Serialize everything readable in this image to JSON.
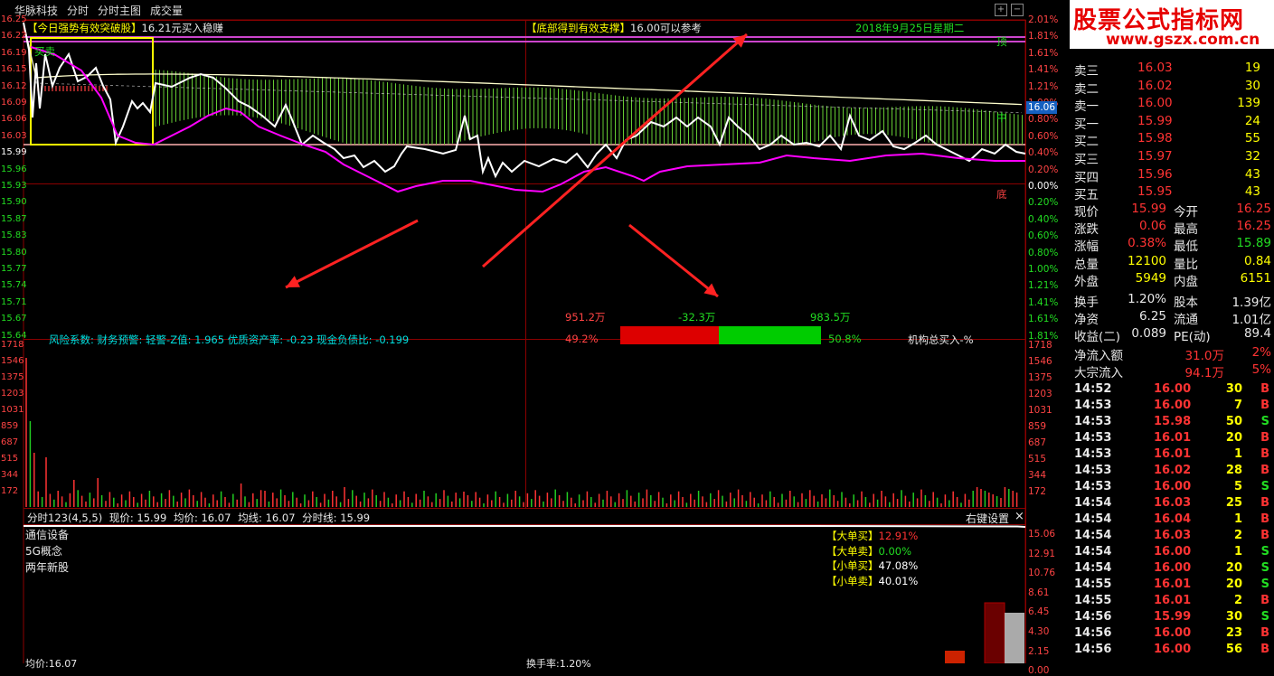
{
  "header": {
    "tabs": [
      "华脉科技",
      "分时",
      "分时主图",
      "成交量"
    ]
  },
  "price_axis_left": [
    "16.25",
    "16.22",
    "16.19",
    "16.15",
    "16.12",
    "16.09",
    "16.06",
    "16.03",
    "15.99",
    "15.96",
    "15.93",
    "15.90",
    "15.87",
    "15.83",
    "15.80",
    "15.77",
    "15.74",
    "15.71",
    "15.67",
    "15.64"
  ],
  "pct_axis_right": [
    "2.01%",
    "1.81%",
    "1.61%",
    "1.41%",
    "1.21%",
    "1.00%",
    "0.80%",
    "0.60%",
    "0.40%",
    "0.20%",
    "0.00%",
    "0.20%",
    "0.40%",
    "0.60%",
    "0.80%",
    "1.00%",
    "1.21%",
    "1.41%",
    "1.61%",
    "1.81%"
  ],
  "current_price_tag": "16.06",
  "annotations": {
    "signal1_a": "【今日强势有效突破股】",
    "signal1_b": "16.21元买入稳赚",
    "signal2_a": "【底部得到有效支撑】",
    "signal2_b": "16.00可以参考",
    "date": "2018年9月25日星期二",
    "top_label": "顶",
    "mid_label": "中",
    "bottom_label": "底",
    "buy_sell_label": "买卖",
    "risk_text": "风险系数: 财务预警: 轻警-Z值: 1.965 优质资产率: -0.23 现金负债比: -0.199",
    "flow_left_amt": "951.2万",
    "flow_mid_amt": "-32.3万",
    "flow_right_amt": "983.5万",
    "flow_left_pct": "49.2%",
    "flow_right_pct": "50.8%",
    "inst_buy": "机构总买入-%"
  },
  "flow_bar": {
    "red_fraction": 0.492,
    "red_color": "#dd0000",
    "green_color": "#00cc00"
  },
  "volume_axis": [
    "1718",
    "1546",
    "1375",
    "1203",
    "1031",
    "859",
    "687",
    "515",
    "344",
    "172"
  ],
  "indicator_bar": {
    "title": "分时123(4,5,5)",
    "now_price": "现价: 15.99",
    "avg_price": "均价: 16.07",
    "avg_line": "均线: 16.07",
    "time_line": "分时线: 15.99",
    "right_settings": "右键设置",
    "close": "×"
  },
  "sectors": [
    "通信设备",
    "5G概念",
    "两年新股"
  ],
  "order_legend": [
    {
      "label": "【大单买】",
      "value": "12.91%",
      "color": "#ff3333"
    },
    {
      "label": "【大单卖】",
      "value": "0.00%",
      "color": "#22dd22"
    },
    {
      "label": "【小单买】",
      "value": "47.08%",
      "color": "#ffffff"
    },
    {
      "label": "【小单卖】",
      "value": "40.01%",
      "color": "#ffffff"
    }
  ],
  "bottom_axis": [
    "15.06",
    "12.91",
    "10.76",
    "8.61",
    "6.45",
    "4.30",
    "2.15",
    "0.00"
  ],
  "bottom_left_text": "均价:16.07",
  "bottom_mid_text": "换手率:1.20%",
  "watermark": {
    "line1": "股票公式指标网",
    "line2": "www.gszx.com.cn"
  },
  "order_book": [
    {
      "label": "卖三",
      "price": "16.03",
      "vol": "19"
    },
    {
      "label": "卖二",
      "price": "16.02",
      "vol": "30"
    },
    {
      "label": "卖一",
      "price": "16.00",
      "vol": "139"
    },
    {
      "label": "买一",
      "price": "15.99",
      "vol": "24"
    },
    {
      "label": "买二",
      "price": "15.98",
      "vol": "55"
    },
    {
      "label": "买三",
      "price": "15.97",
      "vol": "32"
    },
    {
      "label": "买四",
      "price": "15.96",
      "vol": "43"
    },
    {
      "label": "买五",
      "price": "15.95",
      "vol": "43"
    }
  ],
  "quote": [
    {
      "l1": "现价",
      "v1": "15.99",
      "c1": "#ff3333",
      "l2": "今开",
      "v2": "16.25",
      "c2": "#ff3333"
    },
    {
      "l1": "涨跌",
      "v1": "0.06",
      "c1": "#ff3333",
      "l2": "最高",
      "v2": "16.25",
      "c2": "#ff3333"
    },
    {
      "l1": "涨幅",
      "v1": "0.38%",
      "c1": "#ff3333",
      "l2": "最低",
      "v2": "15.89",
      "c2": "#22dd22"
    },
    {
      "l1": "总量",
      "v1": "12100",
      "c1": "#ffff00",
      "l2": "量比",
      "v2": "0.84",
      "c2": "#ffff00"
    },
    {
      "l1": "外盘",
      "v1": "5949",
      "c1": "#ffff00",
      "l2": "内盘",
      "v2": "6151",
      "c2": "#ffff00"
    },
    {
      "l1": "换手",
      "v1": "1.20%",
      "c1": "#e8e8e8",
      "l2": "股本",
      "v2": "1.39亿",
      "c2": "#e8e8e8"
    },
    {
      "l1": "净资",
      "v1": "6.25",
      "c1": "#e8e8e8",
      "l2": "流通",
      "v2": "1.01亿",
      "c2": "#e8e8e8"
    },
    {
      "l1": "收益(二)",
      "v1": "0.089",
      "c1": "#e8e8e8",
      "l2": "PE(动)",
      "v2": "89.4",
      "c2": "#e8e8e8"
    }
  ],
  "net_flow": [
    {
      "label": "净流入额",
      "value": "31.0万",
      "pct": "2%"
    },
    {
      "label": "大宗流入",
      "value": "94.1万",
      "pct": "5%"
    }
  ],
  "ticks": [
    {
      "time": "14:52",
      "price": "16.00",
      "vol": "30",
      "side": "B"
    },
    {
      "time": "14:53",
      "price": "16.00",
      "vol": "7",
      "side": "B"
    },
    {
      "time": "14:53",
      "price": "15.98",
      "vol": "50",
      "side": "S"
    },
    {
      "time": "14:53",
      "price": "16.01",
      "vol": "20",
      "side": "B"
    },
    {
      "time": "14:53",
      "price": "16.01",
      "vol": "1",
      "side": "B"
    },
    {
      "time": "14:53",
      "price": "16.02",
      "vol": "28",
      "side": "B"
    },
    {
      "time": "14:53",
      "price": "16.00",
      "vol": "5",
      "side": "S"
    },
    {
      "time": "14:54",
      "price": "16.03",
      "vol": "25",
      "side": "B"
    },
    {
      "time": "14:54",
      "price": "16.04",
      "vol": "1",
      "side": "B"
    },
    {
      "time": "14:54",
      "price": "16.03",
      "vol": "2",
      "side": "B"
    },
    {
      "time": "14:54",
      "price": "16.00",
      "vol": "1",
      "side": "S"
    },
    {
      "time": "14:54",
      "price": "16.00",
      "vol": "20",
      "side": "S"
    },
    {
      "time": "14:55",
      "price": "16.01",
      "vol": "20",
      "side": "S"
    },
    {
      "time": "14:55",
      "price": "16.01",
      "vol": "2",
      "side": "B"
    },
    {
      "time": "14:56",
      "price": "15.99",
      "vol": "30",
      "side": "S"
    },
    {
      "time": "14:56",
      "price": "16.00",
      "vol": "23",
      "side": "B"
    },
    {
      "time": "14:56",
      "price": "16.00",
      "vol": "56",
      "side": "B"
    }
  ],
  "colors": {
    "up": "#ff3333",
    "down": "#22dd22",
    "grid": "#8b0000",
    "price_line": "#ffffff",
    "avg_line": "#ff00ff",
    "ma_line": "#ffffcc",
    "yellow": "#ffff00"
  }
}
